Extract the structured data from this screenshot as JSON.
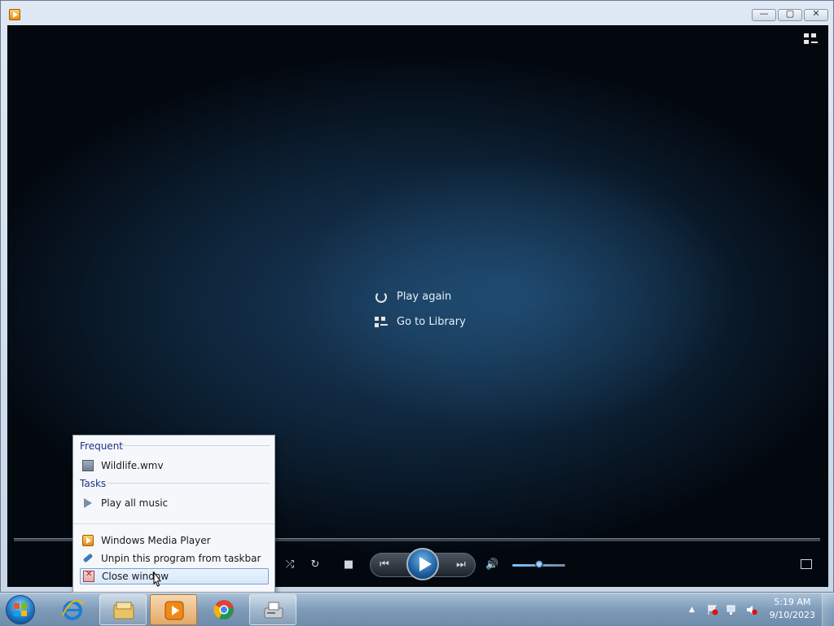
{
  "window": {
    "caption_buttons": {
      "minimize": "—",
      "maximize": "▢",
      "close": "✕"
    }
  },
  "player": {
    "links": [
      {
        "label": "Play again",
        "icon": "replay-icon"
      },
      {
        "label": "Go to Library",
        "icon": "library-icon"
      }
    ],
    "volume_level": 0.5
  },
  "jumplist": {
    "frequent_header": "Frequent",
    "frequent_items": [
      {
        "label": "Wildlife.wmv",
        "icon": "video-file-icon"
      }
    ],
    "tasks_header": "Tasks",
    "task_items": [
      {
        "label": "Play all music",
        "icon": "play-icon"
      }
    ],
    "program_items": [
      {
        "label": "Windows Media Player",
        "icon": "wmp-icon"
      },
      {
        "label": "Unpin this program from taskbar",
        "icon": "unpin-icon"
      },
      {
        "label": "Close window",
        "icon": "close-window-icon"
      }
    ]
  },
  "taskbar": {
    "items": [
      "Internet Explorer",
      "Windows Explorer",
      "Windows Media Player",
      "Google Chrome",
      "Fax and Scan"
    ],
    "clock_time": "5:19 AM",
    "clock_date": "9/10/2023"
  },
  "colors": {
    "accent": "#1c5ea0",
    "video_bg": "#0d2236",
    "jumplist_header": "#1e3287"
  }
}
